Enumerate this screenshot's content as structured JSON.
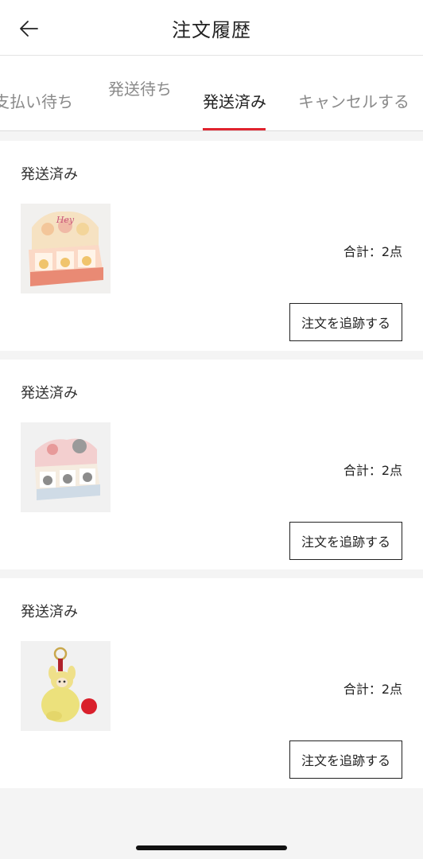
{
  "header": {
    "title": "注文履歴",
    "back_icon": "arrow-left-icon"
  },
  "tabs": [
    {
      "label": "支払い待ち",
      "active": false
    },
    {
      "label": "発送待ち",
      "active": false
    },
    {
      "label": "発送済み",
      "active": true
    },
    {
      "label": "キャンセルする",
      "active": false
    }
  ],
  "colors": {
    "accent": "#e0242f",
    "background": "#f4f4f4",
    "card": "#ffffff"
  },
  "orders": [
    {
      "status": "発送済み",
      "total": "合計：2点",
      "track_label": "注文を追跡する",
      "image": "blind-box-display-peach"
    },
    {
      "status": "発送済み",
      "total": "合計：2点",
      "track_label": "注文を追跡する",
      "image": "blind-box-display-gray"
    },
    {
      "status": "発送済み",
      "total": "合計：2点",
      "track_label": "注文を追跡する",
      "image": "yellow-plush-keychain"
    }
  ]
}
